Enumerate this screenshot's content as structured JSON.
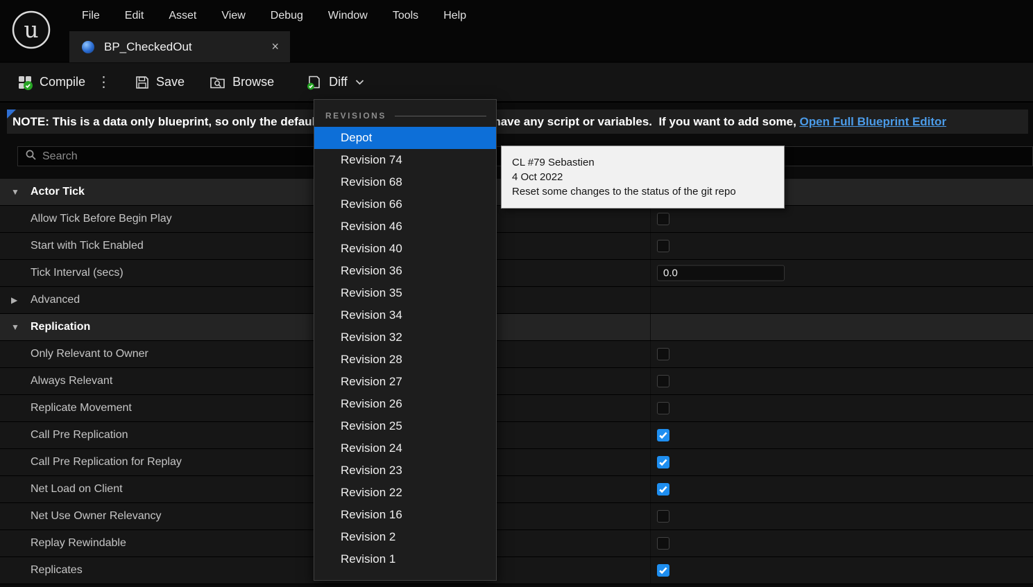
{
  "menubar": {
    "items": [
      "File",
      "Edit",
      "Asset",
      "View",
      "Debug",
      "Window",
      "Tools",
      "Help"
    ]
  },
  "tab": {
    "title": "BP_CheckedOut"
  },
  "toolbar": {
    "compile": "Compile",
    "save": "Save",
    "browse": "Browse",
    "diff": "Diff"
  },
  "note": {
    "prefix": "NOTE: This is a data only blueprint, so only the default values are shown.  It does not have any script or variables.  If you want to add some, ",
    "link": "Open Full Blueprint Editor"
  },
  "search": {
    "placeholder": "Search"
  },
  "details": {
    "rows": [
      {
        "type": "category",
        "label": "Actor Tick",
        "expanded": true
      },
      {
        "type": "checkbox",
        "label": "Allow Tick Before Begin Play",
        "checked": false
      },
      {
        "type": "checkbox",
        "label": "Start with Tick Enabled",
        "checked": false
      },
      {
        "type": "number",
        "label": "Tick Interval (secs)",
        "value": "0.0"
      },
      {
        "type": "expander",
        "label": "Advanced",
        "expanded": false
      },
      {
        "type": "category",
        "label": "Replication",
        "expanded": true
      },
      {
        "type": "checkbox",
        "label": "Only Relevant to Owner",
        "checked": false
      },
      {
        "type": "checkbox",
        "label": "Always Relevant",
        "checked": false
      },
      {
        "type": "checkbox",
        "label": "Replicate Movement",
        "checked": false
      },
      {
        "type": "checkbox",
        "label": "Call Pre Replication",
        "checked": true
      },
      {
        "type": "checkbox",
        "label": "Call Pre Replication for Replay",
        "checked": true
      },
      {
        "type": "checkbox",
        "label": "Net Load on Client",
        "checked": true
      },
      {
        "type": "checkbox",
        "label": "Net Use Owner Relevancy",
        "checked": false
      },
      {
        "type": "checkbox",
        "label": "Replay Rewindable",
        "checked": false
      },
      {
        "type": "checkbox",
        "label": "Replicates",
        "checked": true
      }
    ]
  },
  "revisions_menu": {
    "header": "REVISIONS",
    "selected": "Depot",
    "items": [
      "Depot",
      "Revision 74",
      "Revision 68",
      "Revision 66",
      "Revision 46",
      "Revision 40",
      "Revision 36",
      "Revision 35",
      "Revision 34",
      "Revision 32",
      "Revision 28",
      "Revision 27",
      "Revision 26",
      "Revision 25",
      "Revision 24",
      "Revision 23",
      "Revision 22",
      "Revision 16",
      "Revision 2",
      "Revision 1"
    ]
  },
  "tooltip": {
    "lines": [
      "CL #79 Sebastien",
      "4 Oct 2022",
      "Reset some changes to the status of the git repo"
    ]
  },
  "icons": {
    "close": "×",
    "kebab": "⋮",
    "chevron_down": "▼",
    "chevron_right": "▶"
  },
  "colors": {
    "accent_blue": "#0d6fd8",
    "check_blue": "#1e8ef0",
    "link_blue": "#4b9be8",
    "badge_green": "#27a525"
  }
}
